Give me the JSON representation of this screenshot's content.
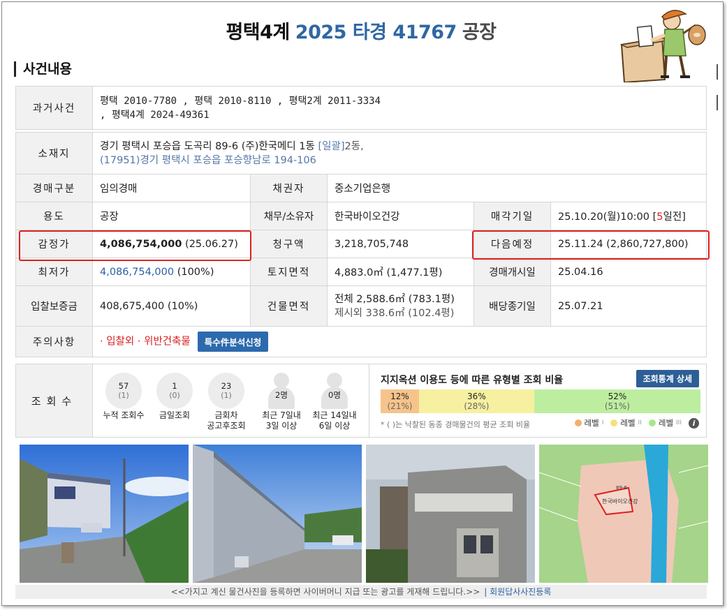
{
  "title": {
    "part1": "평택4계",
    "part2": "2025 타경 41767",
    "part3": "공장"
  },
  "section_title": "사건내용",
  "past_cases": {
    "label": "과거사건",
    "line1": "평택 2010-7780 , 평택 2010-8110 , 평택2계 2011-3334",
    "line2": ", 평택4계 2024-49361"
  },
  "location": {
    "label": "소재지",
    "address": "경기 평택시 포승읍 도곡리 89-6 (주)한국메디 1동 ",
    "bulk": "[일괄]",
    "bulk_tail": "2동,",
    "road": "(17951)경기 평택시 포승읍 포승향남로 194-106"
  },
  "rows": {
    "auction_type": {
      "label": "경매구분",
      "value": "임의경매"
    },
    "creditor": {
      "label": "채권자",
      "value": "중소기업은행"
    },
    "usage": {
      "label": "용도",
      "value": "공장"
    },
    "debtor": {
      "label": "채무/소유자",
      "value": "한국바이오건강"
    },
    "sale_date": {
      "label": "매각기일",
      "value": "25.10.20(월)10:00 [",
      "days": "5",
      "tail": "일전]"
    },
    "appraisal": {
      "label": "감정가",
      "value": "4,086,754,000",
      "date": "(25.06.27)"
    },
    "claim": {
      "label": "청구액",
      "value": "3,218,705,748"
    },
    "next_sale": {
      "label": "다음예정",
      "value": "25.11.24 (2,860,727,800)"
    },
    "min_price": {
      "label": "최저가",
      "value": "4,086,754,000",
      "pct": "(100%)"
    },
    "land_area": {
      "label": "토지면적",
      "value": "4,883.0㎡ (1,477.1평)"
    },
    "auction_start": {
      "label": "경매개시일",
      "value": "25.04.16"
    },
    "deposit": {
      "label": "입찰보증금",
      "value": "408,675,400 (10%)"
    },
    "building_area": {
      "label": "건물면적",
      "line1": "전체 2,588.6㎡ (783.1평)",
      "line2": "제시외 338.6㎡ (102.4평)"
    },
    "dividend_end": {
      "label": "배당종기일",
      "value": "25.07.21"
    },
    "notes": {
      "label": "주의사항",
      "value": "· 입찰외 · 위반건축물",
      "button": "특수件분석신청"
    }
  },
  "views": {
    "label": "조회수",
    "stats": [
      {
        "num": "57",
        "sub": "(1)",
        "cap1": "누적 조회수",
        "cap2": ""
      },
      {
        "num": "1",
        "sub": "(0)",
        "cap1": "금일조회",
        "cap2": ""
      },
      {
        "num": "23",
        "sub": "(1)",
        "cap1": "금회차",
        "cap2": "공고후조회"
      },
      {
        "num": "2명",
        "sub": "",
        "cap1": "최근 7일내",
        "cap2": "3일 이상"
      },
      {
        "num": "0명",
        "sub": "",
        "cap1": "최근 14일내",
        "cap2": "6일 이상"
      }
    ],
    "ratio_title": "지지옥션 이용도 등에 따른 유형별 조회 비율",
    "ratio_button": "조회통계 상세",
    "ratio_segments": [
      {
        "pct": "12%",
        "avg": "(21%)",
        "value": 12,
        "color": "#f6c48a"
      },
      {
        "pct": "36%",
        "avg": "(28%)",
        "value": 36,
        "color": "#f6f0a0"
      },
      {
        "pct": "52%",
        "avg": "(51%)",
        "value": 52,
        "color": "#bdeea0"
      }
    ],
    "ratio_note": "* ( )는 낙찰된 동종 경매물건의 평균 조회 비율",
    "legend": [
      {
        "label": "레벨",
        "mark": "I",
        "color": "#f0b070"
      },
      {
        "label": "레벨",
        "mark": "II",
        "color": "#f4e27a"
      },
      {
        "label": "레벨",
        "mark": "III",
        "color": "#a8e68c"
      }
    ],
    "info_icon": "i"
  },
  "map": {
    "label1": "한국바이오건강",
    "label2": "89-6"
  },
  "footer": {
    "text": "<<가지고 계신 물건사진을 등록하면 사이버머니 지급 또는 광고를 게재해 드립니다.>>",
    "link": "| 회원답사사진등록"
  }
}
